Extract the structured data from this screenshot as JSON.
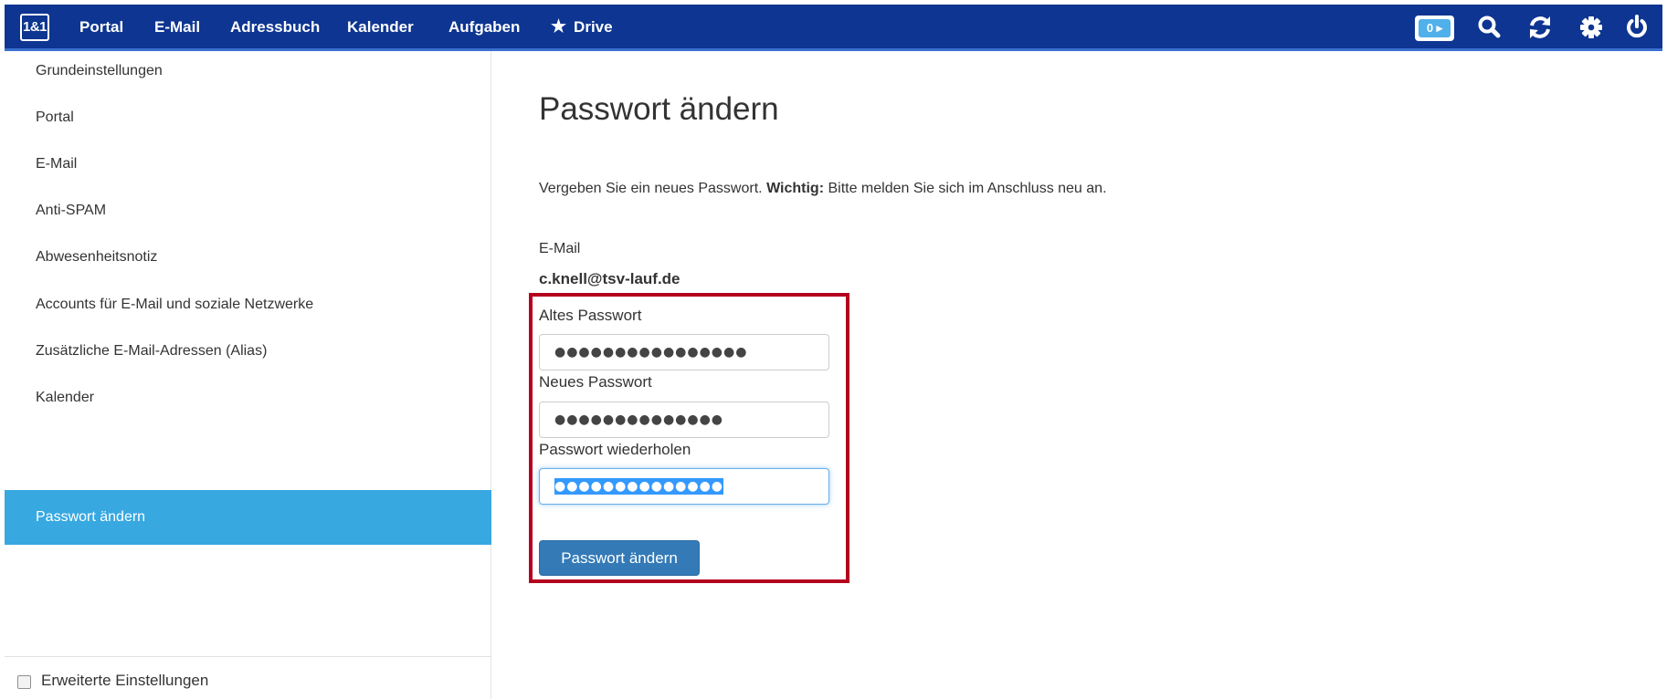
{
  "topbar": {
    "logo_text": "1&1",
    "nav": [
      {
        "label": "Portal"
      },
      {
        "label": "E-Mail"
      },
      {
        "label": "Adressbuch"
      },
      {
        "label": "Kalender"
      },
      {
        "label": "Aufgaben"
      },
      {
        "label": "Drive",
        "icon": "star-icon"
      }
    ],
    "notification_count": "0 ▸",
    "icons": [
      "search-icon",
      "refresh-icon",
      "gear-icon",
      "power-icon"
    ],
    "colors": {
      "bar": "#0d3591",
      "counter": "#4fb0ea"
    }
  },
  "sidebar": {
    "items": [
      {
        "label": "Grundeinstellungen"
      },
      {
        "label": "Portal"
      },
      {
        "label": "E-Mail"
      },
      {
        "label": "Anti-SPAM"
      },
      {
        "label": "Abwesenheitsnotiz"
      },
      {
        "label": "Accounts für E-Mail und soziale Netzwerke"
      },
      {
        "label": "Zusätzliche E-Mail-Adressen (Alias)"
      },
      {
        "label": "Kalender"
      },
      {
        "label": "Passwort ändern",
        "active": true
      }
    ],
    "footer_checkbox_label": "Erweiterte Einstellungen",
    "footer_checkbox_checked": false,
    "active_color": "#38a8e1"
  },
  "main": {
    "title": "Passwort ändern",
    "intro_text": "Vergeben Sie ein neues Passwort.",
    "intro_bold": "Wichtig:",
    "intro_rest": "Bitte melden Sie sich im Anschluss neu an.",
    "email_label": "E-Mail",
    "email_value": "c.knell@tsv-lauf.de",
    "old_password_label": "Altes Passwort",
    "old_password_value": "●●●●●●●●●●●●●●●●",
    "new_password_label": "Neues Passwort",
    "new_password_value": "●●●●●●●●●●●●●●",
    "repeat_password_label": "Passwort wiederholen",
    "repeat_password_value": "●●●●●●●●●●●●●●",
    "submit_label": "Passwort ändern",
    "highlight_color": "#b4001e",
    "button_color": "#337ab7"
  }
}
